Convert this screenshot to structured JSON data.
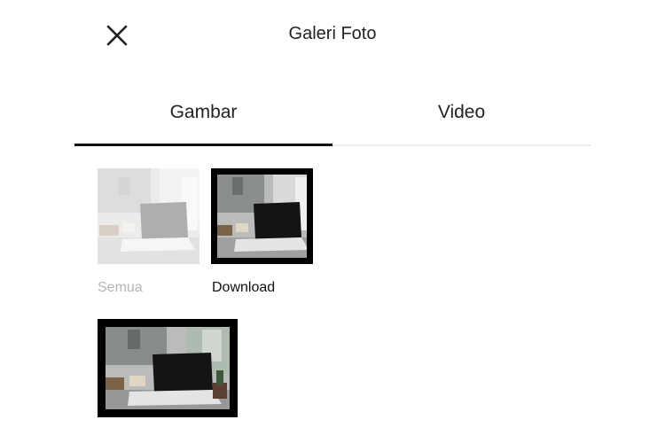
{
  "header": {
    "title": "Galeri Foto",
    "close_icon": "close-icon"
  },
  "tabs": [
    {
      "label": "Gambar",
      "active": true
    },
    {
      "label": "Video",
      "active": false
    }
  ],
  "albums": [
    {
      "label": "Semua",
      "selected": false
    },
    {
      "label": "Download",
      "selected": true
    },
    {
      "label": "",
      "selected": true
    }
  ],
  "colors": {
    "accent": "#111111",
    "muted_label": "#b5b5b5",
    "divider": "#ececec"
  }
}
